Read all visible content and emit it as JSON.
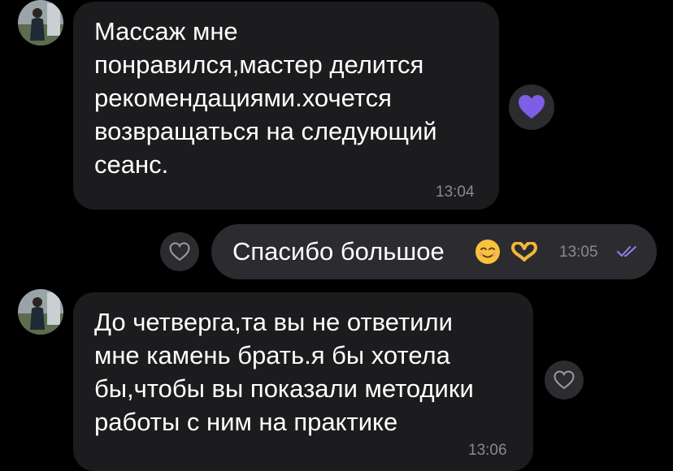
{
  "messages": [
    {
      "direction": "incoming",
      "text": "Массаж мне\nпонравился,мастер делится\nрекомендациями.хочется\nвозвращаться на следующий\nсеанс.",
      "time": "13:04",
      "reaction": "purple-heart"
    },
    {
      "direction": "outgoing",
      "text": "Спасибо большое",
      "emojis": [
        "smiling-face-icon",
        "heart-hands-icon"
      ],
      "time": "13:05",
      "status": "read-double-check"
    },
    {
      "direction": "incoming",
      "text": "До четверга,та вы не ответили\nмне камень брать.я бы хотела\nбы,чтобы вы показали методики\nработы с ним на практике",
      "time": "13:06",
      "reaction": "none"
    }
  ],
  "colors": {
    "background": "#000000",
    "incoming_bubble": "#1c1c1e",
    "outgoing_bubble": "#2c2c30",
    "time_text": "#8a8a8f",
    "reaction_purple": "#7e5ee6",
    "read_check": "#8e83e8"
  }
}
